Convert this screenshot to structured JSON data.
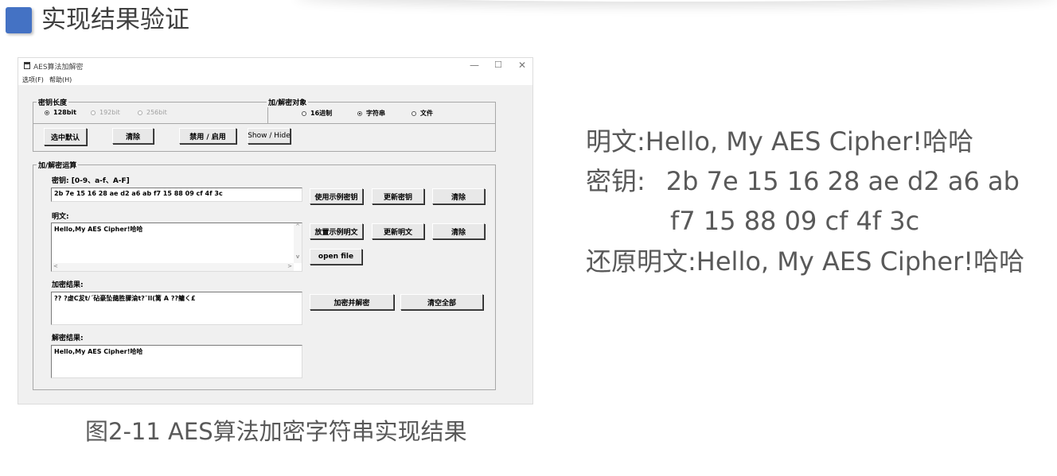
{
  "slide": {
    "title": "实现结果验证",
    "caption": "图2-11 AES算法加密字符串实现结果"
  },
  "window": {
    "title": "AES算法加解密",
    "controls": {
      "minimize": "—",
      "maximize": "☐",
      "close": "✕"
    },
    "menu": [
      "选项(F)",
      "帮助(H)"
    ],
    "key_length_group": {
      "legend": "密钥长度",
      "options": [
        {
          "label": "128bit",
          "selected": true,
          "enabled": true
        },
        {
          "label": "192bit",
          "selected": false,
          "enabled": false
        },
        {
          "label": "256bit",
          "selected": false,
          "enabled": false
        }
      ]
    },
    "object_group": {
      "legend": "加/解密对象",
      "options": [
        {
          "label": "16进制",
          "selected": false
        },
        {
          "label": "字符串",
          "selected": true
        },
        {
          "label": "文件",
          "selected": false
        }
      ]
    },
    "buttons_row": {
      "default": "选中默认",
      "clear": "清除",
      "toggle": "禁用 / 启用",
      "show_hide": "Show / Hide"
    },
    "operation_group": {
      "legend": "加/解密运算",
      "key_label": "密钥: [0-9、a-f、A-F]",
      "key_value": "2b 7e 15 16 28 ae d2 a6 ab f7 15 88 09 cf 4f 3c",
      "key_buttons": {
        "example": "使用示例密钥",
        "update": "更新密钥",
        "clear": "清除"
      },
      "plain_label": "明文:",
      "plain_value": "Hello,My AES Cipher!哈哈",
      "plain_buttons": {
        "example": "放置示例明文",
        "update": "更新明文",
        "clear": "清除",
        "open": "open file"
      },
      "cipher_label": "加密结果:",
      "cipher_value": "??    ?虚C犮t/´砧豪坠藹胜骤淪t?˜ll(篱 A ??鳙く£",
      "cipher_buttons": {
        "encrypt": "加密并解密",
        "clear_all": "清空全部"
      },
      "decrypt_label": "解密结果:",
      "decrypt_value": "Hello,My AES Cipher!哈哈"
    }
  },
  "info": {
    "plaintext_label": "明文:",
    "plaintext": "Hello, My AES Cipher!哈哈",
    "key_label": "密钥:",
    "key_line1": "2b 7e 15 16 28 ae d2 a6 ab",
    "key_line2": "f7 15 88 09 cf 4f 3c",
    "restored_label": "还原明文:",
    "restored": "Hello, My AES Cipher!哈哈"
  },
  "colors": {
    "marker": "#4472c4",
    "window_bg": "#f0f0f0",
    "text_gray": "#595959"
  }
}
